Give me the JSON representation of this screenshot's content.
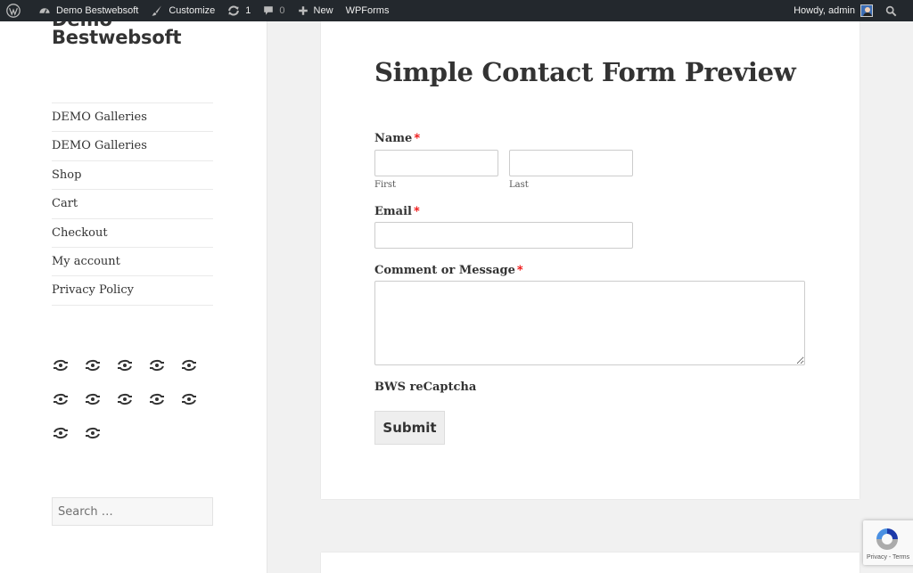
{
  "admin_bar": {
    "wp_logo": "wordpress-icon",
    "site_name": "Demo Bestwebsoft",
    "customize": "Customize",
    "updates_count": "1",
    "comments_count": "0",
    "new": "New",
    "wpforms": "WPForms",
    "greeting": "Howdy, admin",
    "search_icon": "search-icon"
  },
  "sidebar": {
    "site_title_partial": "Demo",
    "site_title": "Bestwebsoft",
    "menu": [
      {
        "label": "DEMO Galleries"
      },
      {
        "label": "DEMO Galleries"
      },
      {
        "label": "Shop"
      },
      {
        "label": "Cart"
      },
      {
        "label": "Checkout"
      },
      {
        "label": "My account"
      },
      {
        "label": "Privacy Policy"
      }
    ],
    "social_icon_count": 12,
    "search_placeholder": "Search …"
  },
  "form": {
    "title": "Simple Contact Form Preview",
    "name_label": "Name",
    "first_sublabel": "First",
    "last_sublabel": "Last",
    "first_value": "",
    "last_value": "",
    "email_label": "Email",
    "email_value": "",
    "message_label": "Comment or Message",
    "message_value": "",
    "required_mark": "*",
    "captcha_label": "BWS reCaptcha",
    "submit_label": "Submit"
  },
  "recaptcha_badge": {
    "terms_text": "Privacy - Terms"
  },
  "colors": {
    "admin_bar_bg": "#23282d",
    "required": "#ee0000",
    "page_bg": "#f1f1f1"
  }
}
